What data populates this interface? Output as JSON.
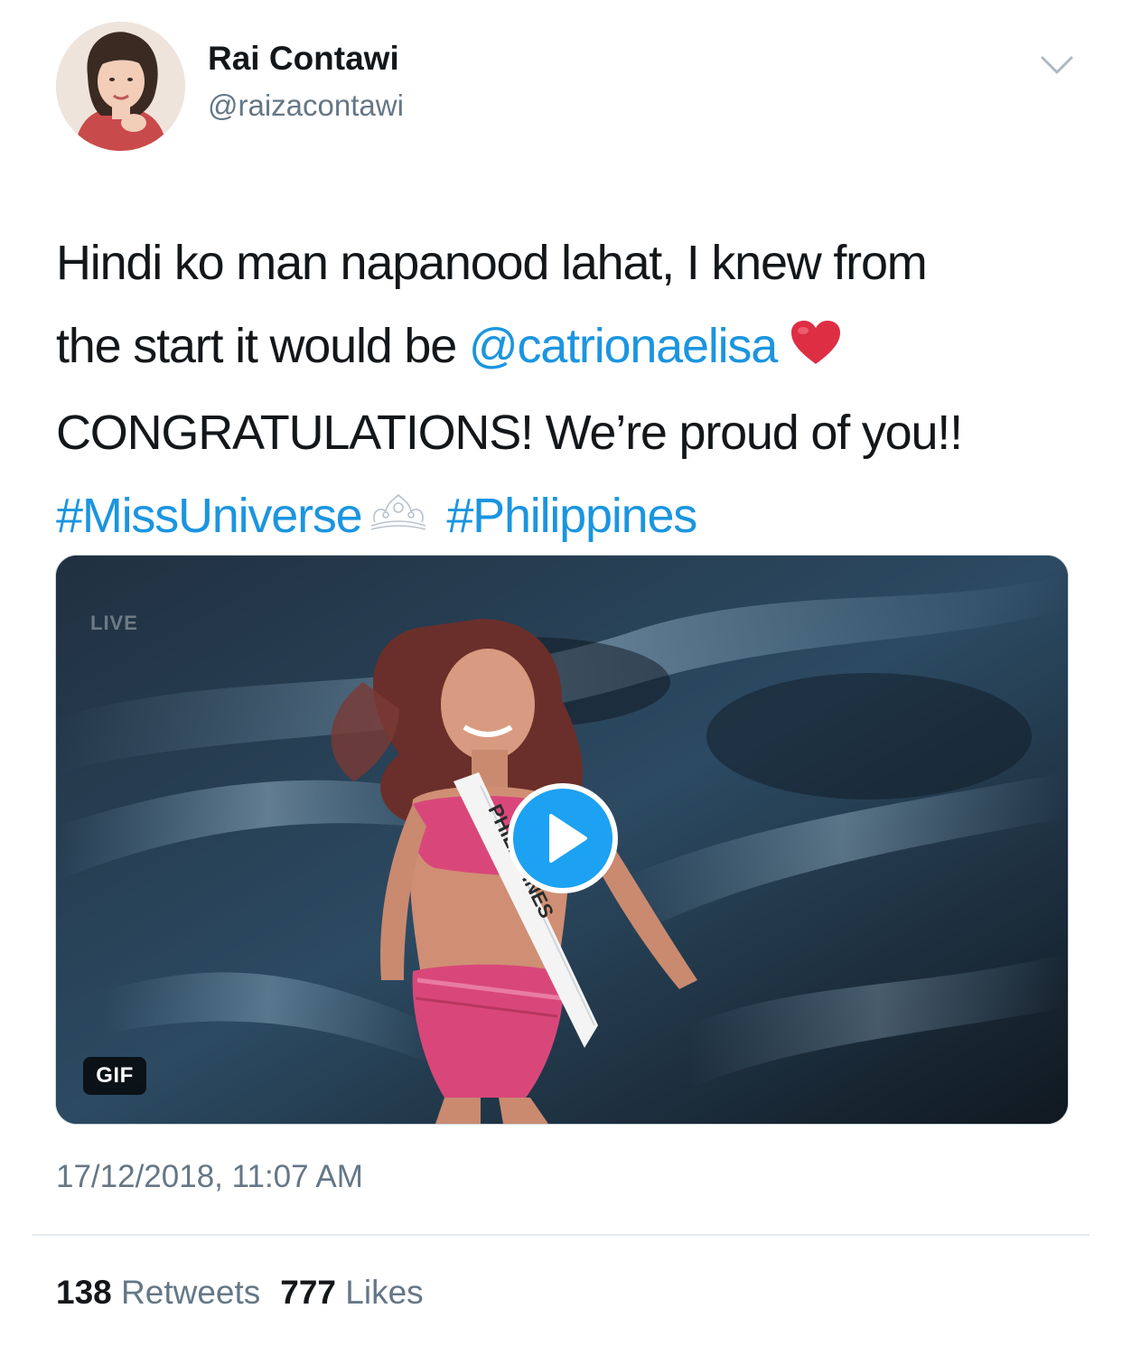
{
  "author": {
    "display_name": "Rai Contawi",
    "handle": "@raizacontawi"
  },
  "tweet": {
    "line1": "Hindi ko man napanood lahat, I knew from",
    "line2_prefix": "the start it would be ",
    "mention": "@catrionaelisa",
    "line3": "CONGRATULATIONS! We’re proud of you!!",
    "hashtag1": "#MissUniverse",
    "hashtag2": "#Philippines"
  },
  "media": {
    "badge": "GIF",
    "overlay_text": "LIVE",
    "sash_text": "PHILIPPINES"
  },
  "meta": {
    "timestamp": "17/12/2018, 11:07 AM"
  },
  "stats": {
    "retweets_count": "138",
    "retweets_label": "Retweets",
    "likes_count": "777",
    "likes_label": "Likes"
  },
  "colors": {
    "link": "#1b95e0",
    "secondary_text": "#657786",
    "heart": "#dd2e44"
  }
}
